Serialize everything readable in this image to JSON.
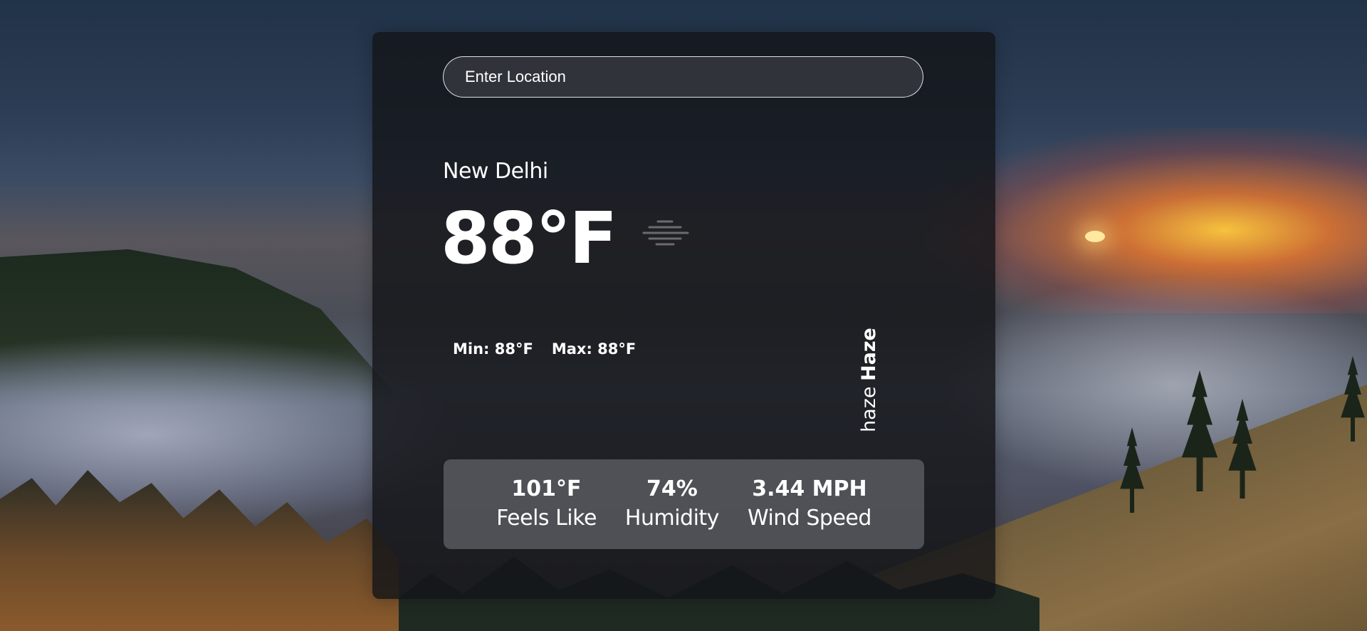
{
  "search": {
    "placeholder": "Enter Location",
    "value": ""
  },
  "weather": {
    "city": "New Delhi",
    "temperature": "88°F",
    "icon": "haze-icon",
    "min": "Min: 88°F",
    "max": "Max: 88°F",
    "condition": "Haze",
    "description": "haze"
  },
  "stats": {
    "feels_like": {
      "value": "101°F",
      "label": "Feels Like"
    },
    "humidity": {
      "value": "74%",
      "label": "Humidity"
    },
    "wind_speed": {
      "value": "3.44 MPH",
      "label": "Wind Speed"
    }
  },
  "colors": {
    "card_background": "#141518",
    "text": "#ffffff",
    "stats_panel": "#78797f"
  }
}
